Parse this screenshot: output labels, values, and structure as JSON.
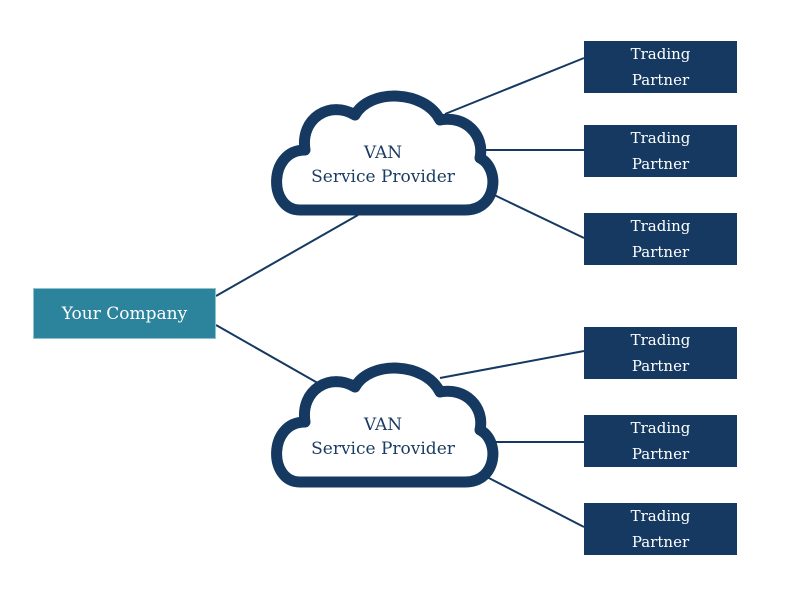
{
  "colors": {
    "company": "#2b839c",
    "partner": "#153961",
    "cloud_stroke": "#153961",
    "line": "#153961"
  },
  "company": {
    "label": "Your Company"
  },
  "clouds": [
    {
      "line1": "VAN",
      "line2": "Service Provider"
    },
    {
      "line1": "VAN",
      "line2": "Service Provider"
    }
  ],
  "partners": [
    {
      "line1": "Trading",
      "line2": "Partner"
    },
    {
      "line1": "Trading",
      "line2": "Partner"
    },
    {
      "line1": "Trading",
      "line2": "Partner"
    },
    {
      "line1": "Trading",
      "line2": "Partner"
    },
    {
      "line1": "Trading",
      "line2": "Partner"
    },
    {
      "line1": "Trading",
      "line2": "Partner"
    }
  ]
}
